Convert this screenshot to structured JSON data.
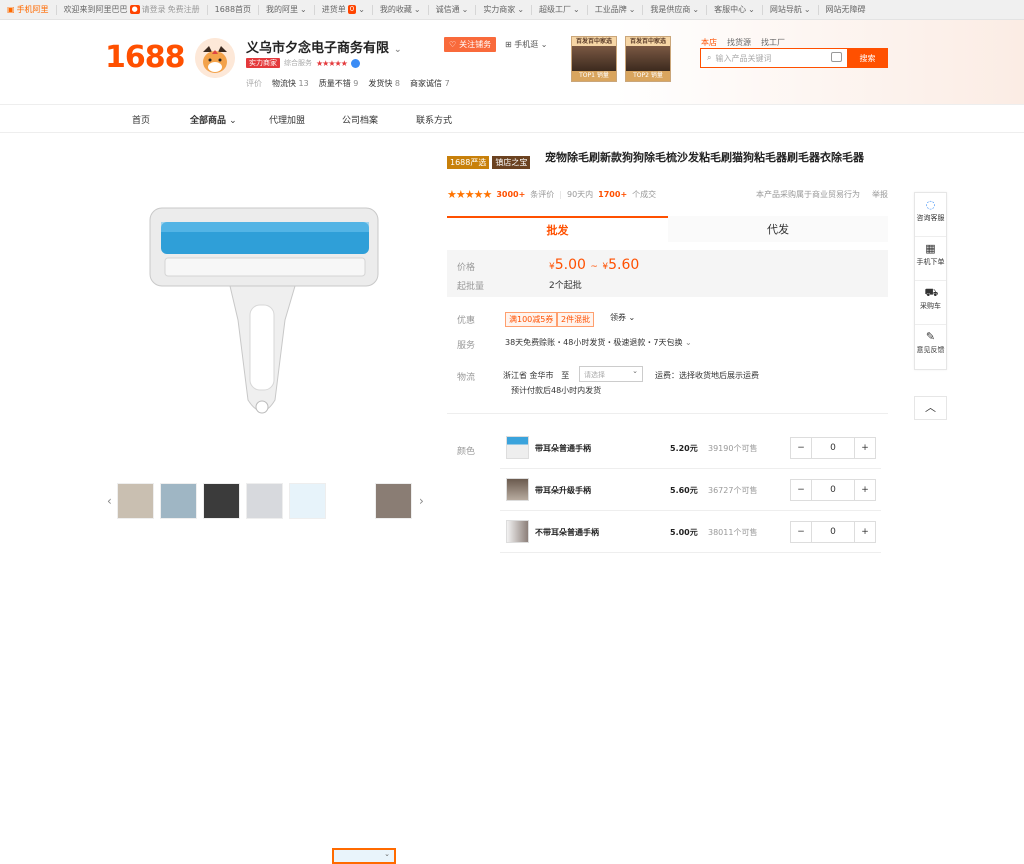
{
  "topbar": {
    "site": "手机阿里",
    "welcome": "欢迎来到阿里巴巴",
    "login": "请登录",
    "register": "免费注册",
    "links": [
      "1688首页",
      "我的阿里",
      "进货单",
      "我的收藏",
      "诚信通",
      "实力商家",
      "超级工厂",
      "工业品牌",
      "我是供应商",
      "客服中心",
      "网站导航",
      "网站无障碍"
    ],
    "cart_count": "0"
  },
  "header": {
    "logo": "1688",
    "company": "义乌市夕念电子商务有限",
    "tag_strength": "实力商家",
    "tag_service": "综合服务",
    "service_stars": "★★★★★",
    "evals_label": "评价",
    "evals": [
      {
        "k": "物流快",
        "v": "13"
      },
      {
        "k": "质量不错",
        "v": "9"
      },
      {
        "k": "发货快",
        "v": "8"
      },
      {
        "k": "商家诚信",
        "v": "7"
      }
    ],
    "follow": "关注铺务",
    "mobile": "手机逛",
    "promos": [
      {
        "title": "百发百中家选",
        "top": "TOP1 销量"
      },
      {
        "title": "百发百中家选",
        "top": "TOP2 销量"
      }
    ],
    "search_tabs": [
      "本店",
      "找货源",
      "找工厂"
    ],
    "search_placeholder": "输入产品关键词",
    "search_button": "搜索"
  },
  "nav": {
    "items": [
      "首页",
      "全部商品",
      "代理加盟",
      "公司档案",
      "联系方式"
    ]
  },
  "product": {
    "tag1": "1688严选",
    "tag2": "镇店之宝",
    "title": "宠物除毛刷新款狗狗除毛梳沙发粘毛刷猫狗粘毛器刷毛器衣除毛器",
    "rating_stars": "★★★★★",
    "review_count": "3000+",
    "review_label": "条评价",
    "sales_prefix": "90天内",
    "sales_count": "1700+",
    "sales_suffix": "个成交",
    "trade_note": "本产品采购属于商业贸易行为",
    "report": "举报",
    "tab_wholesale": "批发",
    "tab_dropship": "代发",
    "price_label": "价格",
    "price_low": "5.00",
    "price_high": "5.60",
    "currency": "¥",
    "moq_label": "起批量",
    "moq": "2个起批",
    "promo_label": "优惠",
    "coupon1": "满100减5券",
    "coupon2": "2件混批",
    "coupon_more": "领券",
    "service_label": "服务",
    "service": "38天免费赊账・48小时发货・极速退款・7天包换",
    "logistics_label": "物流",
    "origin": "浙江省 金华市",
    "to": "至",
    "dest_placeholder": "请选择",
    "freight": "运费：选择收货地后展示运费",
    "pay_note": "预计付款后48小时内发货",
    "color_label": "颜色",
    "skus": [
      {
        "name": "带耳朵普通手柄",
        "price": "5.20元",
        "sold": "39190个可售",
        "qty": "0"
      },
      {
        "name": "带耳朵升级手柄",
        "price": "5.60元",
        "sold": "36727个可售",
        "qty": "0"
      },
      {
        "name": "不带耳朵普通手柄",
        "price": "5.00元",
        "sold": "38011个可售",
        "qty": "0"
      }
    ]
  },
  "tools": [
    {
      "icon": "chat-icon",
      "label": "咨询客服"
    },
    {
      "icon": "qrcode-icon",
      "label": "手机下单"
    },
    {
      "icon": "cart-icon",
      "label": "采购车"
    },
    {
      "icon": "edit-icon",
      "label": "意见反馈"
    }
  ],
  "colors": {
    "accent": "#ff5000",
    "brand": "#ff6a00"
  }
}
